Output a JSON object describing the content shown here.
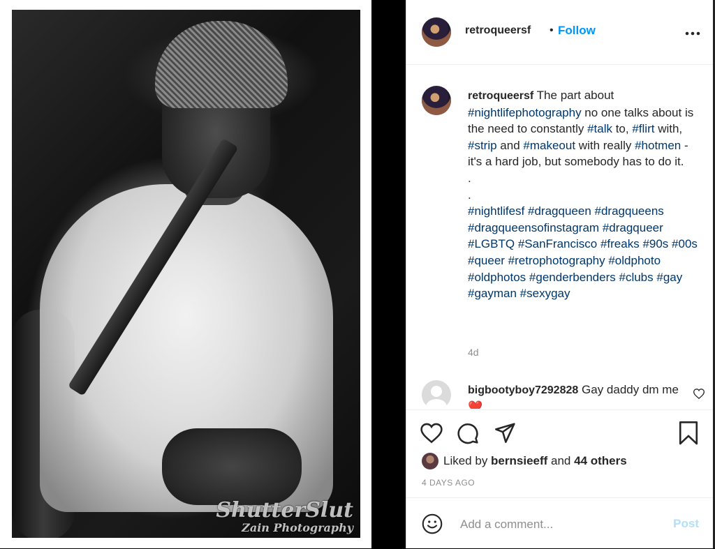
{
  "photo": {
    "alt_subject": "black and white portrait",
    "watermark_line1": "ShutterSlut",
    "watermark_line2": "Zain Photography"
  },
  "post": {
    "username": "retroqueersf",
    "separator": "•",
    "follow_label": "Follow",
    "more_label": "•••",
    "caption_segments": [
      {
        "t": "The part about ",
        "tag": false
      },
      {
        "t": "#nightlifephotography",
        "tag": true
      },
      {
        "t": " no one talks about is the need to constantly ",
        "tag": false
      },
      {
        "t": "#talk",
        "tag": true
      },
      {
        "t": " to, ",
        "tag": false
      },
      {
        "t": "#flirt",
        "tag": true
      },
      {
        "t": " with, ",
        "tag": false
      },
      {
        "t": "#strip",
        "tag": true
      },
      {
        "t": " and ",
        "tag": false
      },
      {
        "t": "#makeout",
        "tag": true
      },
      {
        "t": " with really ",
        "tag": false
      },
      {
        "t": "#hotmen",
        "tag": true
      },
      {
        "t": " - it's a hard job, but somebody has to do it.",
        "tag": false
      }
    ],
    "caption_dots": [
      ".",
      "."
    ],
    "hashtags": [
      "#nightlifesf",
      "#dragqueen",
      "#dragqueens",
      "#dragqueensofinstagram",
      "#dragqueer",
      "#LGBTQ",
      "#SanFrancisco",
      "#freaks",
      "#90s",
      "#00s",
      "#queer",
      "#retrophotography",
      "#oldphoto",
      "#oldphotos",
      "#genderbenders",
      "#clubs",
      "#gay",
      "#gayman",
      "#sexygay"
    ],
    "caption_age": "4d",
    "comments": [
      {
        "username": "bigbootyboy7292828",
        "text": "Gay daddy dm me",
        "emoji": "❤️"
      }
    ],
    "likes": {
      "prefix": "Liked by ",
      "user": "bernsieeff",
      "middle": " and ",
      "others": "44 others"
    },
    "date_label": "4 DAYS AGO",
    "comment_placeholder": "Add a comment...",
    "post_button": "Post"
  },
  "colors": {
    "follow_blue": "#0095f6",
    "hashtag": "#00376b",
    "post_disabled": "#b2dffc",
    "muted": "#8e8e8e"
  },
  "icons": [
    "heart-icon",
    "comment-icon",
    "share-icon",
    "bookmark-icon",
    "emoji-icon",
    "more-icon"
  ]
}
